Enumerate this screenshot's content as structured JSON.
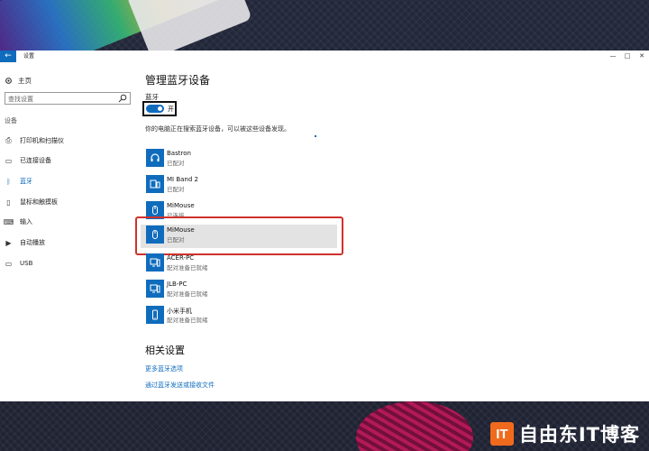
{
  "window": {
    "title": "设置",
    "back_icon": "back-arrow-icon",
    "controls": [
      "—",
      "□",
      "✕"
    ]
  },
  "sidebar": {
    "home_label": "主页",
    "search_placeholder": "查找设置",
    "section_label": "设备",
    "items": [
      {
        "label": "打印机和扫描仪",
        "icon": "printer-icon",
        "active": false
      },
      {
        "label": "已连接设备",
        "icon": "connected-devices-icon",
        "active": false
      },
      {
        "label": "蓝牙",
        "icon": "bluetooth-icon",
        "active": true
      },
      {
        "label": "鼠标和触摸板",
        "icon": "mouse-icon",
        "active": false
      },
      {
        "label": "输入",
        "icon": "keyboard-icon",
        "active": false
      },
      {
        "label": "自动播放",
        "icon": "autoplay-icon",
        "active": false
      },
      {
        "label": "USB",
        "icon": "usb-icon",
        "active": false
      }
    ]
  },
  "main": {
    "title": "管理蓝牙设备",
    "bluetooth_label": "蓝牙",
    "toggle_state": "开",
    "toggle_on": true,
    "discover_message": "你的电脑正在搜索蓝牙设备，可以被这些设备发现。",
    "devices": [
      {
        "name": "Bastron",
        "status": "已配对",
        "icon": "headphones-icon",
        "selected": false
      },
      {
        "name": "MI Band 2",
        "status": "已配对",
        "icon": "device-icon",
        "selected": false
      },
      {
        "name": "MiMouse",
        "status": "已连接",
        "icon": "mouse-icon",
        "selected": false
      },
      {
        "name": "MiMouse",
        "status": "已配对",
        "icon": "mouse-icon",
        "selected": true
      },
      {
        "name": "ACER-PC",
        "status": "配对准备已就绪",
        "icon": "computer-icon",
        "selected": false
      },
      {
        "name": "JLB-PC",
        "status": "配对准备已就绪",
        "icon": "computer-icon",
        "selected": false
      },
      {
        "name": "小米手机",
        "status": "配对准备已就绪",
        "icon": "phone-icon",
        "selected": false
      }
    ],
    "related_title": "相关设置",
    "links": [
      "更多蓝牙选项",
      "通过蓝牙发送或接收文件"
    ]
  },
  "watermark": {
    "logo": "IT",
    "text": "自由东IT博客"
  },
  "colors": {
    "accent": "#0f6cbd",
    "highlight": "#d0312d",
    "selected_bg": "#e3e3e3"
  }
}
